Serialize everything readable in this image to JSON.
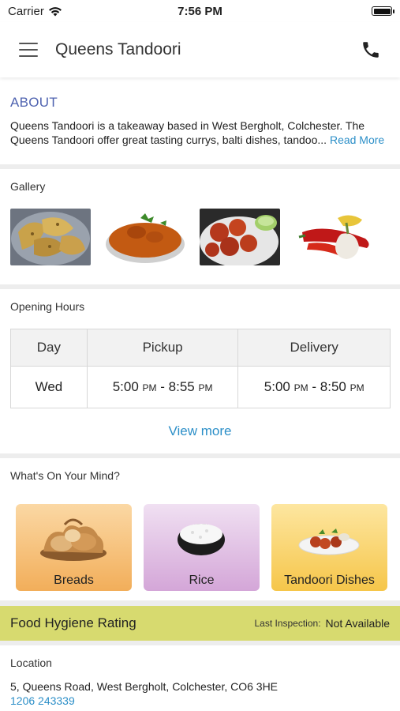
{
  "status_bar": {
    "carrier": "Carrier",
    "time": "7:56 PM"
  },
  "header": {
    "title": "Queens Tandoori"
  },
  "about": {
    "title": "ABOUT",
    "text": "Queens Tandoori is a takeaway based in West Bergholt, Colchester. The Queens Tandoori offer great tasting currys, balti dishes, tandoo...",
    "read_more": "Read More"
  },
  "gallery": {
    "title": "Gallery"
  },
  "hours": {
    "title": "Opening Hours",
    "headers": [
      "Day",
      "Pickup",
      "Delivery"
    ],
    "row": {
      "day": "Wed",
      "pickup_start": "5:00",
      "pickup_start_ampm": "PM",
      "pickup_end": "8:55",
      "pickup_end_ampm": "PM",
      "delivery_start": "5:00",
      "delivery_start_ampm": "PM",
      "delivery_end": "8:50",
      "delivery_end_ampm": "PM"
    },
    "view_more": "View more"
  },
  "mind": {
    "title": "What's On Your Mind?",
    "categories": [
      {
        "label": "Breads",
        "color": "#f3b870"
      },
      {
        "label": "Rice",
        "color": "#d9b4dc"
      },
      {
        "label": "Tandoori Dishes",
        "color": "#fbd66a"
      }
    ]
  },
  "hygiene": {
    "title": "Food Hygiene Rating",
    "last_inspection_label": "Last Inspection:",
    "last_inspection_value": "Not Available"
  },
  "location": {
    "title": "Location",
    "address": "5, Queens Road, West Bergholt, Colchester, CO6 3HE",
    "phone": "1206 243339"
  }
}
